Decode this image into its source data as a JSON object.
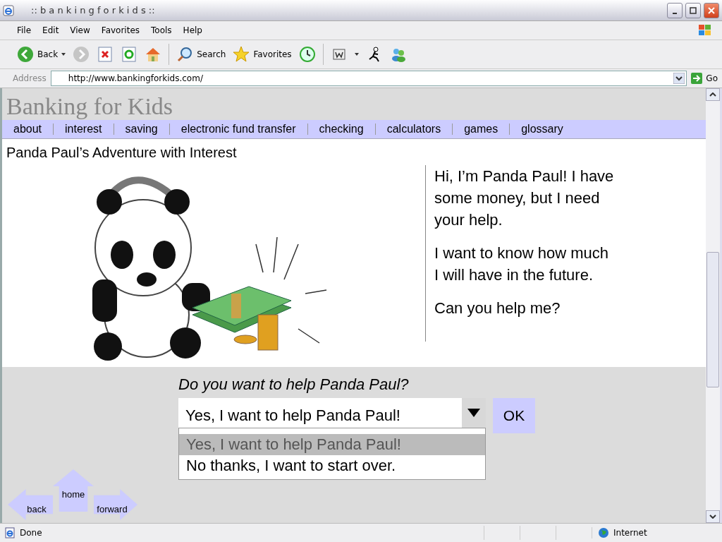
{
  "window": {
    "title": ":: b a n k i n g f o r k i d s ::"
  },
  "menu": [
    "File",
    "Edit",
    "View",
    "Favorites",
    "Tools",
    "Help"
  ],
  "toolbar": {
    "back": "Back",
    "search": "Search",
    "favorites": "Favorites"
  },
  "address": {
    "label": "Address",
    "url": "http://www.bankingforkids.com/",
    "go": "Go"
  },
  "page": {
    "logo": "Banking for Kids",
    "nav": [
      {
        "label": "about"
      },
      {
        "label": "interest"
      },
      {
        "label": "saving"
      },
      {
        "label": "electronic fund transfer"
      },
      {
        "label": "checking"
      },
      {
        "label": "calculators"
      },
      {
        "label": "games"
      },
      {
        "label": "glossary"
      }
    ],
    "heading": "Panda Paul’s Adventure with Interest",
    "speech": [
      "Hi, I’m Panda Paul!  I have some money, but I need your help.",
      "I want to know how much I will have in the future.",
      "Can you help me?"
    ],
    "question": "Do you want to help Panda Paul?",
    "select": {
      "value": "Yes, I want to help Panda Paul!",
      "options": [
        {
          "label": "Yes, I want to help Panda Paul!",
          "selected": true
        },
        {
          "label": "No thanks, I want to start over.",
          "selected": false
        }
      ]
    },
    "ok": "OK",
    "arrows": [
      {
        "label": "back",
        "kind": "left"
      },
      {
        "label": "home",
        "kind": "up"
      },
      {
        "label": "forward",
        "kind": "right"
      }
    ]
  },
  "status_bar": {
    "text": "Done",
    "zone": "Internet"
  }
}
